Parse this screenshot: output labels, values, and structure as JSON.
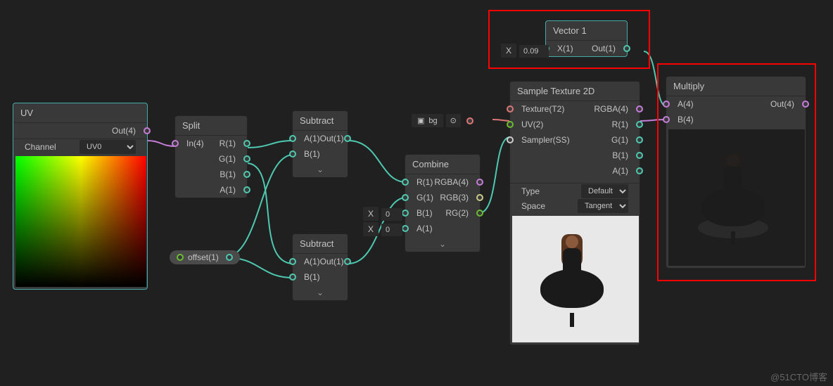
{
  "uv": {
    "title": "UV",
    "out": "Out(4)",
    "channelLabel": "Channel",
    "channelValue": "UV0"
  },
  "split": {
    "title": "Split",
    "in": "In(4)",
    "r": "R(1)",
    "g": "G(1)",
    "b": "B(1)",
    "a": "A(1)"
  },
  "offset": {
    "label": "offset(1)"
  },
  "subtract1": {
    "title": "Subtract",
    "a": "A(1)",
    "b": "B(1)",
    "out": "Out(1)"
  },
  "subtract2": {
    "title": "Subtract",
    "a": "A(1)",
    "b": "B(1)",
    "out": "Out(1)"
  },
  "combine": {
    "title": "Combine",
    "r": "R(1)",
    "g": "G(1)",
    "b": "B(1)",
    "a": "A(1)",
    "rgba": "RGBA(4)",
    "rgb": "RGB(3)",
    "rg": "RG(2)",
    "x1": "0",
    "x2": "0",
    "xlabel": "X"
  },
  "vector1": {
    "title": "Vector 1",
    "xlabel": "X",
    "xval": "0.09",
    "in": "X(1)",
    "out": "Out(1)"
  },
  "bg": {
    "label": "bg"
  },
  "sample": {
    "title": "Sample Texture 2D",
    "texture": "Texture(T2)",
    "uv": "UV(2)",
    "sampler": "Sampler(SS)",
    "rgba": "RGBA(4)",
    "r": "R(1)",
    "g": "G(1)",
    "b": "B(1)",
    "a": "A(1)",
    "typeLabel": "Type",
    "typeVal": "Default",
    "spaceLabel": "Space",
    "spaceVal": "Tangent"
  },
  "multiply": {
    "title": "Multiply",
    "a": "A(4)",
    "b": "B(4)",
    "out": "Out(4)"
  },
  "watermark": "@51CTO博客"
}
